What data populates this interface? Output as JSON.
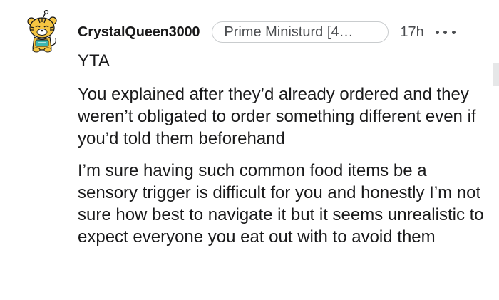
{
  "comment": {
    "username": "CrystalQueen3000",
    "flair": "Prime Ministurd [4…",
    "timestamp": "17h",
    "more_icon": "more-horizontal-icon",
    "avatar_icon": "snoo-tiger-avatar-icon",
    "paragraphs": [
      "YTA",
      "You explained after they’d already ordered and they weren’t obligated to order something different even if you’d told them beforehand",
      "I’m sure having such common food items be a sensory trigger is difficult for you and honestly I’m not sure how best to navigate it but it seems unrealistic to expect everyone you eat out with to avoid them"
    ]
  },
  "colors": {
    "text_primary": "#1a1a1b",
    "text_secondary": "#4a4c4f",
    "flair_border": "#c9ccce",
    "avatar_yellow": "#f5c542",
    "avatar_teal": "#3db6b0"
  }
}
